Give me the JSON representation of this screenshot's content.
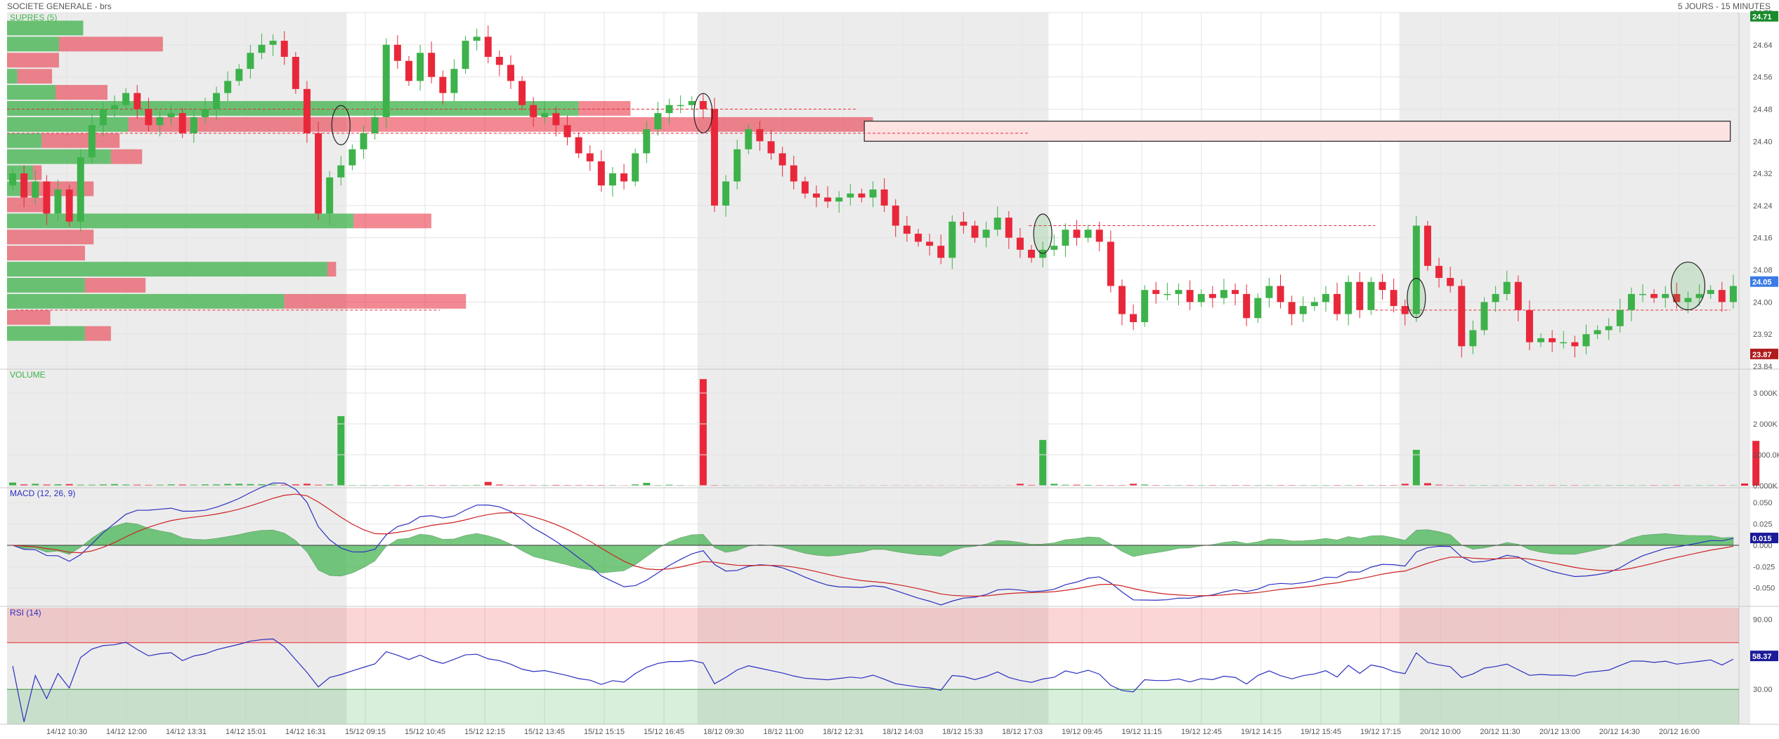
{
  "header": {
    "title": "SOCIETE GENERALE - brs",
    "period": "5 JOURS - 15 MINUTES"
  },
  "colors": {
    "up": "#3db24a",
    "down": "#e8283a",
    "shade": "#ececec",
    "macd": "#2b2fc0",
    "signal": "#cc2222",
    "rsi": "#2b2fc0",
    "grid": "#e3e3e3",
    "axis": "#555555"
  },
  "panels": {
    "price": {
      "label": "SUPRES (5)"
    },
    "volume": {
      "label": "VOLUME"
    },
    "macd": {
      "label": "MACD (12, 26, 9)"
    },
    "rsi": {
      "label": "RSI (14)"
    }
  },
  "chart_data": {
    "type": "candlestick",
    "x_ticks": [
      "14/12 10:30",
      "14/12 12:00",
      "14/12 13:31",
      "14/12 15:01",
      "14/12 16:31",
      "15/12 09:15",
      "15/12 10:45",
      "15/12 12:15",
      "15/12 13:45",
      "15/12 15:15",
      "15/12 16:45",
      "18/12 09:30",
      "18/12 11:00",
      "18/12 12:31",
      "18/12 14:03",
      "18/12 15:33",
      "18/12 17:03",
      "19/12 09:45",
      "19/12 11:15",
      "19/12 12:45",
      "19/12 14:15",
      "19/12 15:45",
      "19/12 17:15",
      "20/12 10:00",
      "20/12 11:30",
      "20/12 13:00",
      "20/12 14:30",
      "20/12 16:00"
    ],
    "price": {
      "ylim": [
        23.84,
        24.72
      ],
      "y_ticks": [
        "24.72",
        "24.64",
        "24.56",
        "24.48",
        "24.40",
        "24.32",
        "24.24",
        "24.16",
        "24.08",
        "24.00",
        "23.92",
        "23.84"
      ],
      "last_price": "24.05",
      "high_marker": "24.71",
      "low_marker": "23.87",
      "closes": [
        24.32,
        24.26,
        24.3,
        24.22,
        24.28,
        24.2,
        24.36,
        24.44,
        24.48,
        24.49,
        24.52,
        24.48,
        24.44,
        24.46,
        24.47,
        24.42,
        24.46,
        24.48,
        24.52,
        24.55,
        24.58,
        24.62,
        24.64,
        24.65,
        24.61,
        24.53,
        24.42,
        24.22,
        24.31,
        24.34,
        24.38,
        24.42,
        24.46,
        24.64,
        24.6,
        24.55,
        24.62,
        24.56,
        24.52,
        24.58,
        24.65,
        24.66,
        24.61,
        24.59,
        24.55,
        24.49,
        24.46,
        24.47,
        24.44,
        24.41,
        24.37,
        24.35,
        24.29,
        24.32,
        24.3,
        24.37,
        24.43,
        24.47,
        24.49,
        24.49,
        24.5,
        24.48,
        24.24,
        24.3,
        24.38,
        24.43,
        24.4,
        24.37,
        24.34,
        24.3,
        24.27,
        24.26,
        24.25,
        24.26,
        24.27,
        24.26,
        24.28,
        24.24,
        24.19,
        24.17,
        24.15,
        24.14,
        24.11,
        24.2,
        24.19,
        24.16,
        24.18,
        24.21,
        24.16,
        24.13,
        24.11,
        24.13,
        24.14,
        24.18,
        24.16,
        24.18,
        24.15,
        24.04,
        23.97,
        23.95,
        24.03,
        24.02,
        24.02,
        24.03,
        24.0,
        24.02,
        24.01,
        24.03,
        24.02,
        23.96,
        24.01,
        24.04,
        24.0,
        23.97,
        23.99,
        24.0,
        24.02,
        23.97,
        24.05,
        23.98,
        24.05,
        24.03,
        23.99,
        23.97,
        24.19,
        24.09,
        24.06,
        24.04,
        23.89,
        23.93,
        24.0,
        24.02,
        24.05,
        23.98,
        23.9,
        23.91,
        23.9,
        23.9,
        23.89,
        23.92,
        23.93,
        23.94,
        23.98,
        24.02,
        24.02,
        24.01,
        24.02,
        24.0,
        24.01,
        24.02,
        24.03,
        24.0,
        24.04
      ],
      "bars_per_day": [
        30,
        31,
        31,
        31,
        31
      ],
      "volume_profile": [
        {
          "price": 23.92,
          "up": 0.045,
          "down": 0.015
        },
        {
          "price": 23.96,
          "up": 0.0,
          "down": 0.025
        },
        {
          "price": 24.0,
          "up": 0.16,
          "down": 0.105
        },
        {
          "price": 24.04,
          "up": 0.045,
          "down": 0.035
        },
        {
          "price": 24.08,
          "up": 0.185,
          "down": 0.005
        },
        {
          "price": 24.12,
          "up": 0.0,
          "down": 0.045
        },
        {
          "price": 24.16,
          "up": 0.0,
          "down": 0.05
        },
        {
          "price": 24.2,
          "up": 0.2,
          "down": 0.045
        },
        {
          "price": 24.24,
          "up": 0.0,
          "down": 0.025
        },
        {
          "price": 24.28,
          "up": 0.012,
          "down": 0.038
        },
        {
          "price": 24.32,
          "up": 0.015,
          "down": 0.005
        },
        {
          "price": 24.36,
          "up": 0.06,
          "down": 0.018
        },
        {
          "price": 24.4,
          "up": 0.02,
          "down": 0.045
        },
        {
          "price": 24.44,
          "up": 0.07,
          "down": 0.43
        },
        {
          "price": 24.48,
          "up": 0.33,
          "down": 0.03
        },
        {
          "price": 24.52,
          "up": 0.028,
          "down": 0.03
        },
        {
          "price": 24.56,
          "up": 0.006,
          "down": 0.02
        },
        {
          "price": 24.6,
          "up": 0.0,
          "down": 0.03
        },
        {
          "price": 24.64,
          "up": 0.03,
          "down": 0.06
        },
        {
          "price": 24.68,
          "up": 0.044,
          "down": 0.0
        }
      ],
      "support_resistance": [
        {
          "from": 0.0,
          "to": 0.49,
          "price": 24.48
        },
        {
          "from": 0.0,
          "to": 0.59,
          "price": 24.42
        },
        {
          "from": 0.59,
          "to": 0.79,
          "price": 24.19
        },
        {
          "from": 0.79,
          "to": 0.995,
          "price": 23.98
        },
        {
          "from": 0.005,
          "to": 0.25,
          "price": 23.98
        }
      ],
      "zone": {
        "from": 0.495,
        "to": 0.995,
        "low": 24.4,
        "high": 24.45
      }
    },
    "volume": {
      "y_ticks": [
        "3 000K",
        "2 000K",
        "1000.0K",
        "0.000K"
      ],
      "ylim": [
        0,
        3500
      ],
      "values": [
        100,
        40,
        60,
        35,
        45,
        50,
        30,
        30,
        40,
        50,
        35,
        30,
        25,
        30,
        40,
        35,
        30,
        40,
        40,
        55,
        60,
        50,
        45,
        35,
        30,
        40,
        60,
        30,
        40,
        2250,
        20,
        20,
        20,
        20,
        20,
        20,
        20,
        20,
        20,
        20,
        20,
        25,
        120,
        35,
        20,
        20,
        20,
        20,
        25,
        20,
        20,
        20,
        20,
        20,
        15,
        40,
        90,
        20,
        30,
        20,
        15,
        3450,
        20,
        20,
        15,
        15,
        15,
        15,
        15,
        15,
        15,
        15,
        15,
        15,
        15,
        15,
        15,
        15,
        15,
        15,
        15,
        15,
        15,
        15,
        15,
        15,
        15,
        15,
        15,
        60,
        25,
        1480,
        60,
        30,
        30,
        25,
        20,
        20,
        20,
        60,
        35,
        20,
        20,
        20,
        20,
        20,
        20,
        20,
        20,
        20,
        20,
        20,
        20,
        20,
        20,
        20,
        20,
        20,
        20,
        20,
        20,
        20,
        20,
        60,
        1160,
        80,
        30,
        20,
        20,
        20,
        20,
        20,
        20,
        20,
        20,
        20,
        20,
        20,
        20,
        20,
        20,
        20,
        20,
        20,
        20,
        20,
        20,
        20,
        20,
        20,
        20,
        20,
        20,
        70,
        1450
      ]
    },
    "macd": {
      "y_ticks": [
        "0.050",
        "0.025",
        "0.000",
        "-0.025",
        "-0.050"
      ],
      "ylim": [
        -0.07,
        0.065
      ],
      "last_value": "0.015"
    },
    "rsi": {
      "y_ticks": [
        "90.00",
        "58.37",
        "30.00"
      ],
      "ylim": [
        0,
        100
      ],
      "overbought": 70,
      "oversold": 30,
      "last_value": "58.37"
    }
  }
}
